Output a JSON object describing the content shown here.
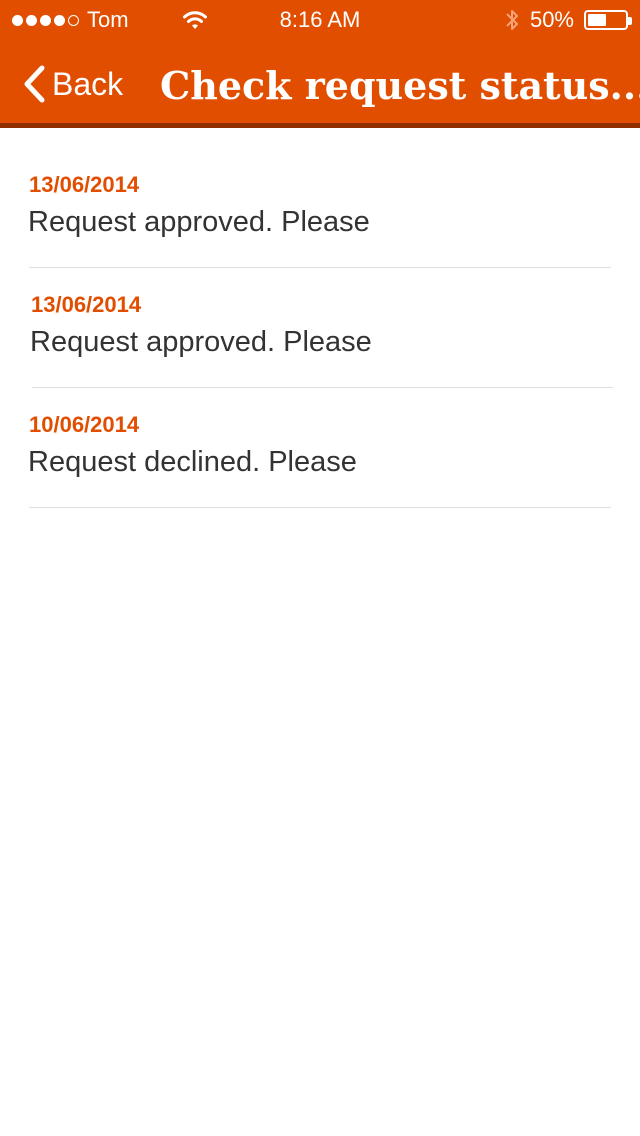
{
  "status_bar": {
    "carrier": "Tom",
    "time": "8:16 AM",
    "battery_percent": "50%",
    "battery_level": 0.5,
    "signal_bars_filled": 4,
    "signal_bars_total": 5,
    "icons": [
      "signal-dots-icon",
      "wifi-icon",
      "bluetooth-icon",
      "battery-icon"
    ]
  },
  "nav": {
    "back_label": "Back",
    "title": "Check request status..."
  },
  "colors": {
    "accent": "#e24e00",
    "nav_border": "#8f2f00",
    "text": "#333333",
    "divider": "#dddddd"
  },
  "requests": [
    {
      "date": "13/06/2014",
      "message": "Request approved. Please"
    },
    {
      "date": "13/06/2014",
      "message": "Request approved. Please"
    },
    {
      "date": "10/06/2014",
      "message": "Request declined. Please"
    }
  ]
}
